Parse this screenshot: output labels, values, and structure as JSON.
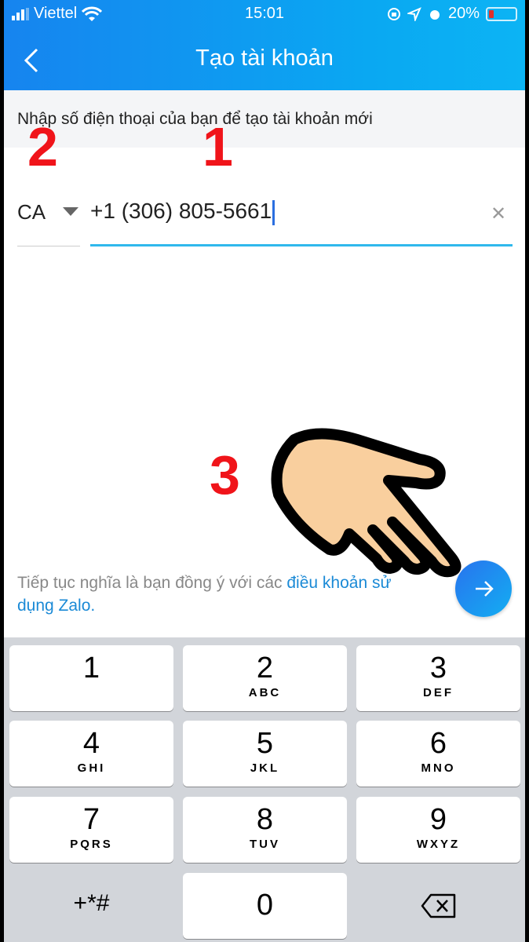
{
  "status_bar": {
    "carrier": "Viettel",
    "time": "15:01",
    "battery": "20%",
    "icons": [
      "signal-icon",
      "wifi-icon",
      "rotation-lock-icon",
      "location-icon",
      "alarm-icon",
      "battery-icon"
    ]
  },
  "header": {
    "title": "Tạo tài khoản",
    "back_icon": "chevron-left-icon"
  },
  "instruction": "Nhập số điện thoại của bạn để tạo tài khoản mới",
  "form": {
    "country_code": "CA",
    "phone_value": "+1 (306) 805-5661",
    "clear_icon": "close-icon"
  },
  "terms": {
    "text": "Tiếp tục nghĩa là bạn đồng ý với các ",
    "link": "điều khoản sử dụng Zalo."
  },
  "next_button": {
    "icon": "arrow-right-icon"
  },
  "annotations": [
    "1",
    "2",
    "3"
  ],
  "keyboard": {
    "keys": [
      {
        "digit": "1",
        "letters": ""
      },
      {
        "digit": "2",
        "letters": "ABC"
      },
      {
        "digit": "3",
        "letters": "DEF"
      },
      {
        "digit": "4",
        "letters": "GHI"
      },
      {
        "digit": "5",
        "letters": "JKL"
      },
      {
        "digit": "6",
        "letters": "MNO"
      },
      {
        "digit": "7",
        "letters": "PQRS"
      },
      {
        "digit": "8",
        "letters": "TUV"
      },
      {
        "digit": "9",
        "letters": "WXYZ"
      },
      {
        "digit": "+*#",
        "letters": ""
      },
      {
        "digit": "0",
        "letters": ""
      },
      {
        "digit": "",
        "letters": ""
      }
    ]
  },
  "colors": {
    "header": "#1684ef",
    "accent": "#30b8ec",
    "link": "#1b8ad6",
    "annotation": "#f0141a"
  }
}
